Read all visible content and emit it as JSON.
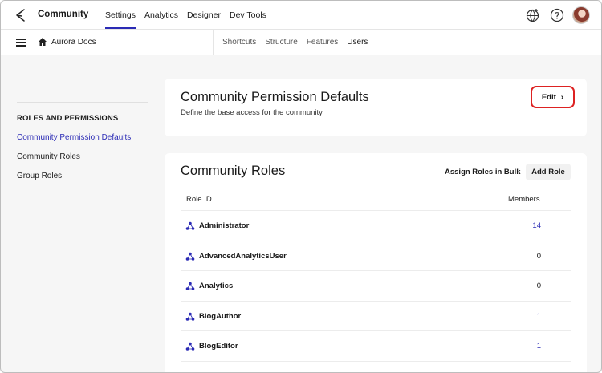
{
  "topbar": {
    "app_name": "Community",
    "nav": [
      "Settings",
      "Analytics",
      "Designer",
      "Dev Tools"
    ],
    "active_nav": "Settings",
    "icons": [
      "globe-icon",
      "help-icon",
      "avatar"
    ]
  },
  "subbar": {
    "site_name": "Aurora Docs",
    "nav": [
      "Shortcuts",
      "Structure",
      "Features",
      "Users"
    ],
    "active_nav": "Users"
  },
  "sidebar": {
    "heading": "ROLES AND PERMISSIONS",
    "items": [
      "Community Permission Defaults",
      "Community Roles",
      "Group Roles"
    ],
    "active_item": "Community Permission Defaults"
  },
  "permission_card": {
    "title": "Community Permission Defaults",
    "description": "Define the base access for the community",
    "edit_label": "Edit",
    "edit_chevron": "›"
  },
  "roles_card": {
    "title": "Community Roles",
    "assign_label": "Assign Roles in Bulk",
    "add_label": "Add Role",
    "columns": [
      "Role ID",
      "Members"
    ],
    "rows": [
      {
        "role": "Administrator",
        "members": "14"
      },
      {
        "role": "AdvancedAnalyticsUser",
        "members": "0"
      },
      {
        "role": "Analytics",
        "members": "0"
      },
      {
        "role": "BlogAuthor",
        "members": "1"
      },
      {
        "role": "BlogEditor",
        "members": "1"
      }
    ]
  },
  "colors": {
    "accent": "#2b2bb5",
    "highlight": "#dd2222"
  }
}
